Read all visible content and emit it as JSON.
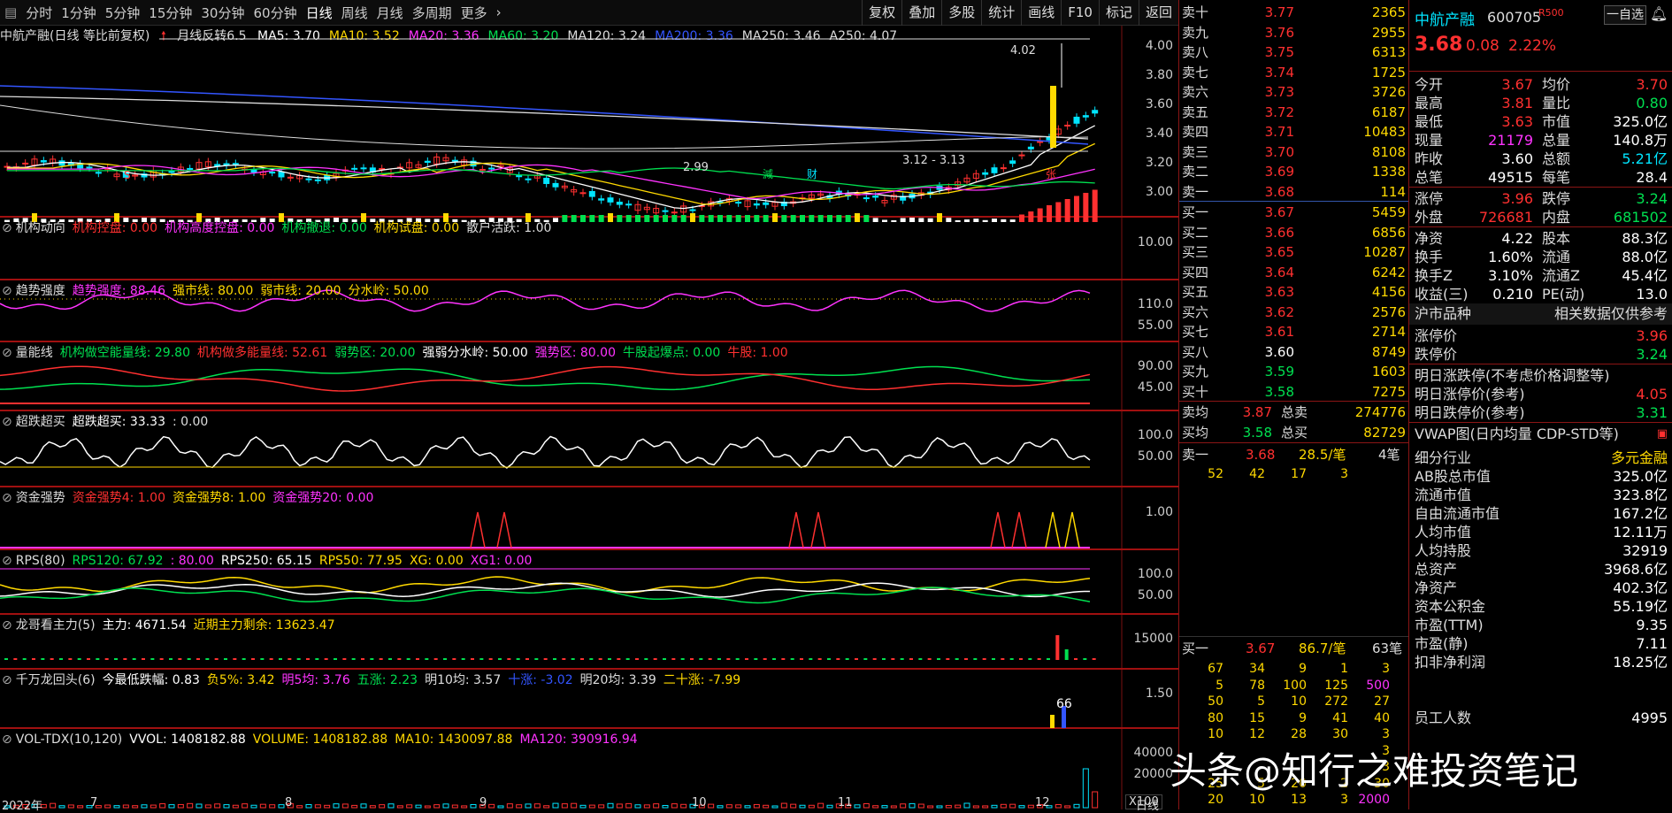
{
  "toolbar": {
    "periods": [
      "分时",
      "1分钟",
      "5分钟",
      "15分钟",
      "30分钟",
      "60分钟",
      "日线",
      "周线",
      "月线",
      "多周期",
      "更多"
    ],
    "selected": "日线",
    "right": [
      "复权",
      "叠加",
      "多股",
      "统计",
      "画线",
      "F10",
      "标记",
      "返回"
    ]
  },
  "main_chart": {
    "title": "中航产融(日线 等比前复权)",
    "signal": "月线反转6.5",
    "ma": [
      {
        "label": "MA5: 3.70",
        "color": "#ffffff"
      },
      {
        "label": "MA10: 3.52",
        "color": "#ffd900"
      },
      {
        "label": "MA20: 3.36",
        "color": "#ff33ff"
      },
      {
        "label": "MA60: 3.20",
        "color": "#00e050"
      },
      {
        "label": "MA120: 3.24",
        "color": "#dddddd"
      },
      {
        "label": "MA200: 3.36",
        "color": "#3355ff"
      },
      {
        "label": "MA250: 3.46",
        "color": "#dddddd"
      },
      {
        "label": "A250: 4.07",
        "color": "#dddddd"
      }
    ],
    "axis": [
      "4.00",
      "3.80",
      "3.60",
      "3.40",
      "3.20",
      "3.00"
    ],
    "annotations": {
      "high": "4.02",
      "low1": "2.99",
      "low2": "3.12 - 3.13",
      "jian": "減",
      "cai": "财",
      "zhang": "张",
      "s": "S"
    }
  },
  "panels": [
    {
      "name": "机构动向",
      "items": [
        {
          "t": "机构控盘: 0.00",
          "c": "#ff3030"
        },
        {
          "t": "机构高度控盘: 0.00",
          "c": "#ff33ff"
        },
        {
          "t": "机构撤退: 0.00",
          "c": "#00e050"
        },
        {
          "t": "机构试盘: 0.00",
          "c": "#ffd900"
        },
        {
          "t": "散户活跃: 1.00",
          "c": "#dddddd"
        }
      ],
      "axis": [
        "10.00"
      ]
    },
    {
      "name": "趋势强度",
      "items": [
        {
          "t": "趋势强度: 88.46",
          "c": "#ff33ff"
        },
        {
          "t": "强市线: 80.00",
          "c": "#ffd900"
        },
        {
          "t": "弱市线: 20.00",
          "c": "#ffd900"
        },
        {
          "t": "分水岭: 50.00",
          "c": "#ffd900"
        }
      ],
      "axis": [
        "110.0",
        "55.00"
      ]
    },
    {
      "name": "量能线",
      "items": [
        {
          "t": "机构做空能量线: 29.80",
          "c": "#00e050"
        },
        {
          "t": "机构做多能量线: 52.61",
          "c": "#ff3030"
        },
        {
          "t": "弱势区: 20.00",
          "c": "#00e050"
        },
        {
          "t": "强弱分水岭: 50.00",
          "c": "#ffffff"
        },
        {
          "t": "强势区: 80.00",
          "c": "#ff33ff"
        },
        {
          "t": "牛股起爆点: 0.00",
          "c": "#00e050"
        },
        {
          "t": "牛股: 1.00",
          "c": "#ff3030"
        }
      ],
      "axis": [
        "90.00",
        "45.00"
      ]
    },
    {
      "name": "超跌超买",
      "items": [
        {
          "t": "超跌超买: 33.33",
          "c": "#ffffff"
        },
        {
          "t": ": 0.00",
          "c": "#dddddd"
        }
      ],
      "axis": [
        "100.0",
        "50.00"
      ]
    },
    {
      "name": "资金强势",
      "items": [
        {
          "t": "资金强势4: 1.00",
          "c": "#ff3030"
        },
        {
          "t": "资金强势8: 1.00",
          "c": "#ffd900"
        },
        {
          "t": "资金强势20: 0.00",
          "c": "#ff33ff"
        }
      ],
      "axis": [
        "1.00"
      ]
    },
    {
      "name": "RPS(80)",
      "items": [
        {
          "t": "RPS120: 67.92",
          "c": "#00e050"
        },
        {
          "t": ": 80.00",
          "c": "#ff33ff"
        },
        {
          "t": "RPS250: 65.15",
          "c": "#ffffff"
        },
        {
          "t": "RPS50: 77.95",
          "c": "#ffd900"
        },
        {
          "t": "XG: 0.00",
          "c": "#ffd900"
        },
        {
          "t": "XG1: 0.00",
          "c": "#ff33ff"
        }
      ],
      "axis": [
        "100.0",
        "50.00"
      ]
    },
    {
      "name": "龙哥看主力(5)",
      "items": [
        {
          "t": "主力: 4671.54",
          "c": "#ffffff"
        },
        {
          "t": "近期主力剩余: 13623.47",
          "c": "#ffd900"
        }
      ],
      "axis": [
        "15000"
      ]
    },
    {
      "name": "千万龙回头(6)",
      "items": [
        {
          "t": "今最低跌幅: 0.83",
          "c": "#ffffff"
        },
        {
          "t": "负5%: 3.42",
          "c": "#ffd900"
        },
        {
          "t": "明5均: 3.76",
          "c": "#ff33ff"
        },
        {
          "t": "五涨: 2.23",
          "c": "#00e050"
        },
        {
          "t": "明10均: 3.57",
          "c": "#dddddd"
        },
        {
          "t": "十涨: -3.02",
          "c": "#3355ff"
        },
        {
          "t": "明20均: 3.39",
          "c": "#dddddd"
        },
        {
          "t": "二十涨: -7.99",
          "c": "#ffd900"
        }
      ],
      "axis": [
        "1.50"
      ],
      "mark": "66"
    },
    {
      "name": "VOL-TDX(10,120)",
      "items": [
        {
          "t": "VVOL: 1408182.88",
          "c": "#ffffff"
        },
        {
          "t": "VOLUME: 1408182.88",
          "c": "#ffd900"
        },
        {
          "t": "MA10: 1430097.88",
          "c": "#ffd900"
        },
        {
          "t": "MA120: 390916.94",
          "c": "#ff33ff"
        }
      ],
      "axis": [
        "40000",
        "20000"
      ],
      "unit": "X100"
    }
  ],
  "x_axis": [
    "2022年",
    "7",
    "8",
    "9",
    "10",
    "11",
    "12"
  ],
  "x_label": "日线",
  "orderbook": {
    "asks": [
      [
        "卖十",
        "3.77",
        "2365"
      ],
      [
        "卖九",
        "3.76",
        "2955"
      ],
      [
        "卖八",
        "3.75",
        "6313"
      ],
      [
        "卖七",
        "3.74",
        "1725"
      ],
      [
        "卖六",
        "3.73",
        "3726"
      ],
      [
        "卖五",
        "3.72",
        "6187"
      ],
      [
        "卖四",
        "3.71",
        "10483"
      ],
      [
        "卖三",
        "3.70",
        "8108"
      ],
      [
        "卖二",
        "3.69",
        "1338"
      ],
      [
        "卖一",
        "3.68",
        "114"
      ]
    ],
    "bids": [
      [
        "买一",
        "3.67",
        "5459"
      ],
      [
        "买二",
        "3.66",
        "6856"
      ],
      [
        "买三",
        "3.65",
        "10287"
      ],
      [
        "买四",
        "3.64",
        "6242"
      ],
      [
        "买五",
        "3.63",
        "4156"
      ],
      [
        "买六",
        "3.62",
        "2576"
      ],
      [
        "买七",
        "3.61",
        "2714"
      ],
      [
        "买八",
        "3.60",
        "8749"
      ],
      [
        "买九",
        "3.59",
        "1603"
      ],
      [
        "买十",
        "3.58",
        "7275"
      ]
    ],
    "avg": [
      [
        "卖均",
        "3.87",
        "总卖",
        "274776"
      ],
      [
        "买均",
        "3.58",
        "总买",
        "82729"
      ]
    ],
    "sell1": {
      "l": "卖一",
      "p": "3.68",
      "v": "28.5/笔",
      "n": "4笔"
    },
    "sell1_queue": [
      "52",
      "42",
      "17",
      "3"
    ],
    "buy1": {
      "l": "买一",
      "p": "3.67",
      "v": "86.7/笔",
      "n": "63笔"
    },
    "buy1_queue": [
      [
        "67",
        "34",
        "9",
        "1",
        "3"
      ],
      [
        "5",
        "78",
        "100",
        "125",
        "500"
      ],
      [
        "50",
        "5",
        "10",
        "272",
        "27"
      ],
      [
        "80",
        "15",
        "9",
        "41",
        "40"
      ],
      [
        "10",
        "12",
        "28",
        "30",
        "3"
      ],
      [
        "",
        "",
        "",
        "",
        "3"
      ],
      [
        "",
        "",
        "",
        "",
        "3"
      ],
      [
        "25",
        "5",
        "20",
        "2",
        "30"
      ],
      [
        "20",
        "10",
        "13",
        "3",
        "2000"
      ]
    ]
  },
  "info": {
    "name": "中航产融",
    "code": "600705",
    "tag": "R500",
    "btn": "一自选",
    "price": "3.68",
    "change": "0.08",
    "pct": "2.22%",
    "rows": [
      [
        "今开",
        "3.67",
        "r",
        "均价",
        "3.70",
        "r"
      ],
      [
        "最高",
        "3.81",
        "r",
        "量比",
        "0.80",
        "g"
      ],
      [
        "最低",
        "3.63",
        "r",
        "市值",
        "325.0亿",
        "w"
      ],
      [
        "现量",
        "21179",
        "m",
        "总量",
        "140.8万",
        "w"
      ],
      [
        "昨收",
        "3.60",
        "w",
        "总额",
        "5.21亿",
        "c"
      ],
      [
        "总笔",
        "49515",
        "w",
        "每笔",
        "28.4",
        "w"
      ]
    ],
    "rows2": [
      [
        "涨停",
        "3.96",
        "r",
        "跌停",
        "3.24",
        "g"
      ],
      [
        "外盘",
        "726681",
        "r",
        "内盘",
        "681502",
        "g"
      ]
    ],
    "rows3": [
      [
        "净资",
        "4.22",
        "w",
        "股本",
        "88.3亿",
        "w"
      ],
      [
        "换手",
        "1.60%",
        "w",
        "流通",
        "88.0亿",
        "w"
      ],
      [
        "换手Z",
        "3.10%",
        "w",
        "流通Z",
        "45.4亿",
        "w"
      ],
      [
        "收益(三)",
        "0.210",
        "w",
        "PE(动)",
        "13.0",
        "w"
      ]
    ],
    "hs": [
      "沪市品种",
      "相关数据仅供参考"
    ],
    "limits": [
      [
        "涨停价",
        "3.96",
        "r"
      ],
      [
        "跌停价",
        "3.24",
        "g"
      ]
    ],
    "tomorrow": [
      "明日涨跌停(不考虑价格调整等)",
      [
        "明日涨停价(参考)",
        "4.05",
        "r"
      ],
      [
        "明日跌停价(参考)",
        "3.31",
        "g"
      ]
    ],
    "vwap": "VWAP图(日内均量 CDP-STD等)",
    "fund": [
      [
        "细分行业",
        "多元金融",
        "y"
      ],
      [
        "AB股总市值",
        "325.0亿",
        "w"
      ],
      [
        "流通市值",
        "323.8亿",
        "w"
      ],
      [
        "自由流通市值",
        "167.2亿",
        "w"
      ],
      [
        "人均市值",
        "12.11万",
        "w"
      ],
      [
        "人均持股",
        "32919",
        "w"
      ],
      [
        "总资产",
        "3968.6亿",
        "w"
      ],
      [
        "净资产",
        "402.3亿",
        "w"
      ],
      [
        "资本公积金",
        "55.19亿",
        "w"
      ],
      [
        "市盈(TTM)",
        "9.35",
        "w"
      ],
      [
        "市盈(静)",
        "7.11",
        "w"
      ],
      [
        "扣非净利润",
        "18.25亿",
        "w"
      ],
      [
        "",
        "",
        "w"
      ],
      [
        "",
        "",
        "w"
      ],
      [
        "员工人数",
        "4995",
        "w"
      ]
    ]
  },
  "watermark": "头条@知行之难投资笔记"
}
